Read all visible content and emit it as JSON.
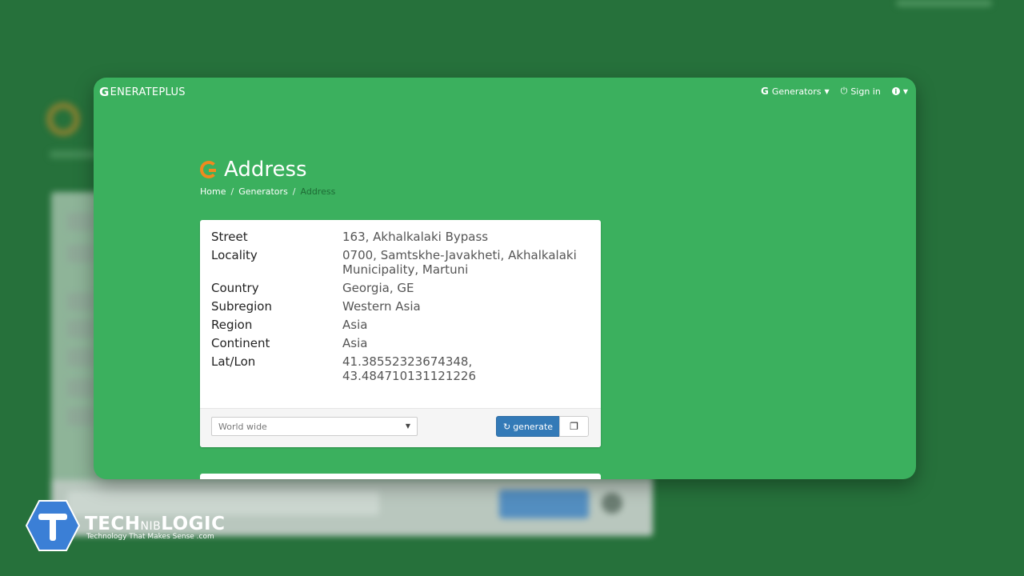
{
  "navbar": {
    "brand": "ENERATEPLUS",
    "brand_initial": "G",
    "generators_label": "Generators",
    "signin_label": "Sign in",
    "info_label": "i"
  },
  "page": {
    "title": "Address",
    "breadcrumb": [
      "Home",
      "Generators",
      "Address"
    ]
  },
  "address": {
    "rows": [
      {
        "key": "Street",
        "value": "163, Akhalkalaki Bypass"
      },
      {
        "key": "Locality",
        "value": "0700, Samtskhe-Javakheti, Akhalkalaki Municipality, Martuni"
      },
      {
        "key": "Country",
        "value": "Georgia, GE"
      },
      {
        "key": "Subregion",
        "value": "Western Asia"
      },
      {
        "key": "Region",
        "value": "Asia"
      },
      {
        "key": "Continent",
        "value": "Asia"
      },
      {
        "key": "Lat/Lon",
        "value": "41.38552323674348, 43.484710131121226"
      }
    ]
  },
  "controls": {
    "region_select": "World wide",
    "generate_label": "generate",
    "copy_icon": "copy-icon"
  },
  "watermark": {
    "name_part1": "TECH",
    "name_part2": "NIB",
    "name_part3": "LOGIC",
    "tagline": "Technology That Makes Sense .com"
  },
  "colors": {
    "primary_green": "#3bb05e",
    "accent_orange": "#f08a1e",
    "button_blue": "#337ab7",
    "background": "#26713b"
  }
}
